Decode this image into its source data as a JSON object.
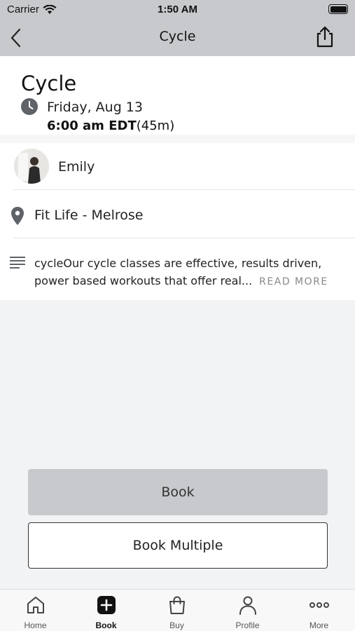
{
  "status_bar": {
    "carrier": "Carrier",
    "time": "1:50 AM"
  },
  "nav": {
    "title": "Cycle"
  },
  "class_info": {
    "title": "Cycle",
    "date": "Friday, Aug 13",
    "start_time": "6:00 am EDT",
    "duration": "(45m)"
  },
  "instructor": {
    "name": "Emily"
  },
  "location": {
    "name": "Fit Life - Melrose"
  },
  "description": {
    "text_line1": "cycleOur cycle classes are effective, results driven,",
    "text_line2": "power based workouts that offer real...",
    "read_more": "READ MORE"
  },
  "actions": {
    "book_label": "Book",
    "book_multiple_label": "Book Multiple"
  },
  "tabs": [
    {
      "label": "Home",
      "icon": "home-icon",
      "active": false
    },
    {
      "label": "Book",
      "icon": "plus-square-icon",
      "active": true
    },
    {
      "label": "Buy",
      "icon": "shopping-bag-icon",
      "active": false
    },
    {
      "label": "Profile",
      "icon": "person-icon",
      "active": false
    },
    {
      "label": "More",
      "icon": "ellipsis-icon",
      "active": false
    }
  ],
  "colors": {
    "header_gray": "#c7c9cc",
    "text_dark": "#222222",
    "read_more_gray": "#888888"
  }
}
